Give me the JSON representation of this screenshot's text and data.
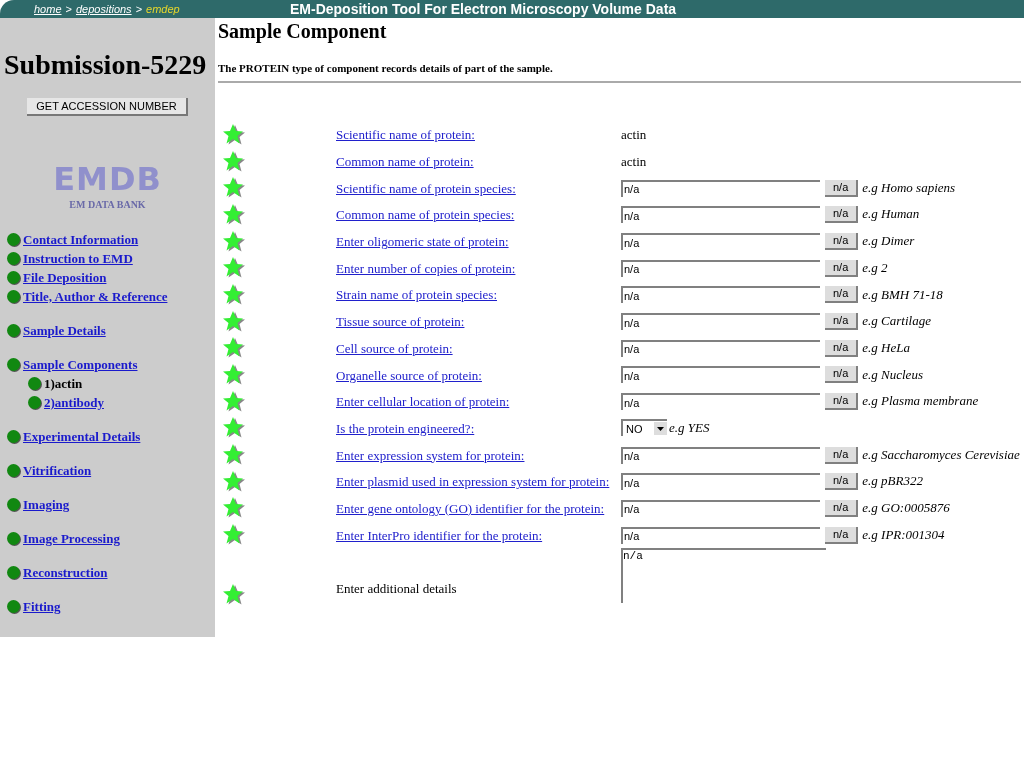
{
  "top_bar": {
    "breadcrumb": [
      {
        "label": "home",
        "current": false
      },
      {
        "label": "depositions",
        "current": false
      },
      {
        "label": "emdep",
        "current": true
      }
    ],
    "separator": ">",
    "title": "EM-Deposition Tool For Electron Microscopy Volume Data"
  },
  "sidebar": {
    "submission": "Submission-5229",
    "accession_button": "GET ACCESSION NUMBER",
    "logo": {
      "mark": "EMDB",
      "caption": "EM DATA BANK"
    },
    "sections": [
      [
        {
          "label": "Contact Information",
          "selected": false
        },
        {
          "label": "Instruction to EMD",
          "selected": false
        },
        {
          "label": "File Deposition",
          "selected": false
        },
        {
          "label": "Title, Author & Reference",
          "selected": false
        }
      ],
      [
        {
          "label": "Sample Details",
          "selected": false
        }
      ],
      [
        {
          "label": "Sample Components",
          "selected": false,
          "children": [
            {
              "label": "1)actin",
              "selected": true
            },
            {
              "label": "2)antibody",
              "selected": false
            }
          ]
        }
      ],
      [
        {
          "label": "Experimental Details",
          "selected": false
        }
      ],
      [
        {
          "label": "Vitrification",
          "selected": false
        }
      ],
      [
        {
          "label": "Imaging",
          "selected": false
        }
      ],
      [
        {
          "label": "Image Processing",
          "selected": false
        }
      ],
      [
        {
          "label": "Reconstruction",
          "selected": false
        }
      ],
      [
        {
          "label": "Fitting",
          "selected": false
        }
      ]
    ]
  },
  "main": {
    "title": "Sample Component",
    "intro": "The PROTEIN type of component records details of part of the sample.",
    "rows": [
      {
        "kind": "text",
        "label": "Scientific name of protein:",
        "value": "actin"
      },
      {
        "kind": "text",
        "label": "Common name of protein:",
        "value": "actin"
      },
      {
        "kind": "input",
        "label": "Scientific name of protein species:",
        "value": "n/a",
        "button": "n/a",
        "example": "e.g Homo sapiens"
      },
      {
        "kind": "input",
        "label": "Common name of protein species:",
        "value": "n/a",
        "button": "n/a",
        "example": "e.g Human"
      },
      {
        "kind": "input",
        "label": "Enter oligomeric state of protein:",
        "value": "n/a",
        "button": "n/a",
        "example": "e.g Dimer"
      },
      {
        "kind": "input",
        "label": "Enter number of copies of protein:",
        "value": "n/a",
        "button": "n/a",
        "example": "e.g 2"
      },
      {
        "kind": "input",
        "label": "Strain name of protein species:",
        "value": "n/a",
        "button": "n/a",
        "example": "e.g BMH 71-18"
      },
      {
        "kind": "input",
        "label": "Tissue source of protein:",
        "value": "n/a",
        "button": "n/a",
        "example": "e.g Cartilage"
      },
      {
        "kind": "input",
        "label": "Cell source of protein:",
        "value": "n/a",
        "button": "n/a",
        "example": "e.g HeLa"
      },
      {
        "kind": "input",
        "label": "Organelle source of protein:",
        "value": "n/a",
        "button": "n/a",
        "example": "e.g Nucleus"
      },
      {
        "kind": "input",
        "label": "Enter cellular location of protein:",
        "value": "n/a",
        "button": "n/a",
        "example": "e.g Plasma membrane"
      },
      {
        "kind": "select",
        "label": "Is the protein engineered?:",
        "value": "NO",
        "example": "e.g YES"
      },
      {
        "kind": "input",
        "label": "Enter expression system for protein:",
        "value": "n/a",
        "button": "n/a",
        "example": "e.g Saccharomyces Cerevisiae"
      },
      {
        "kind": "input",
        "label": "Enter plasmid used in expression system for protein:",
        "value": "n/a",
        "button": "n/a",
        "example": "e.g pBR322"
      },
      {
        "kind": "input",
        "label": "Enter gene ontology (GO) identifier for the protein:",
        "value": "n/a",
        "button": "n/a",
        "example": "e.g GO:0005876"
      },
      {
        "kind": "input",
        "label": "Enter InterPro identifier for the protein:",
        "value": "n/a",
        "button": "n/a",
        "example": "e.g IPR:001304"
      },
      {
        "kind": "textarea",
        "label": "Enter additional details",
        "value": "n/a"
      }
    ]
  }
}
